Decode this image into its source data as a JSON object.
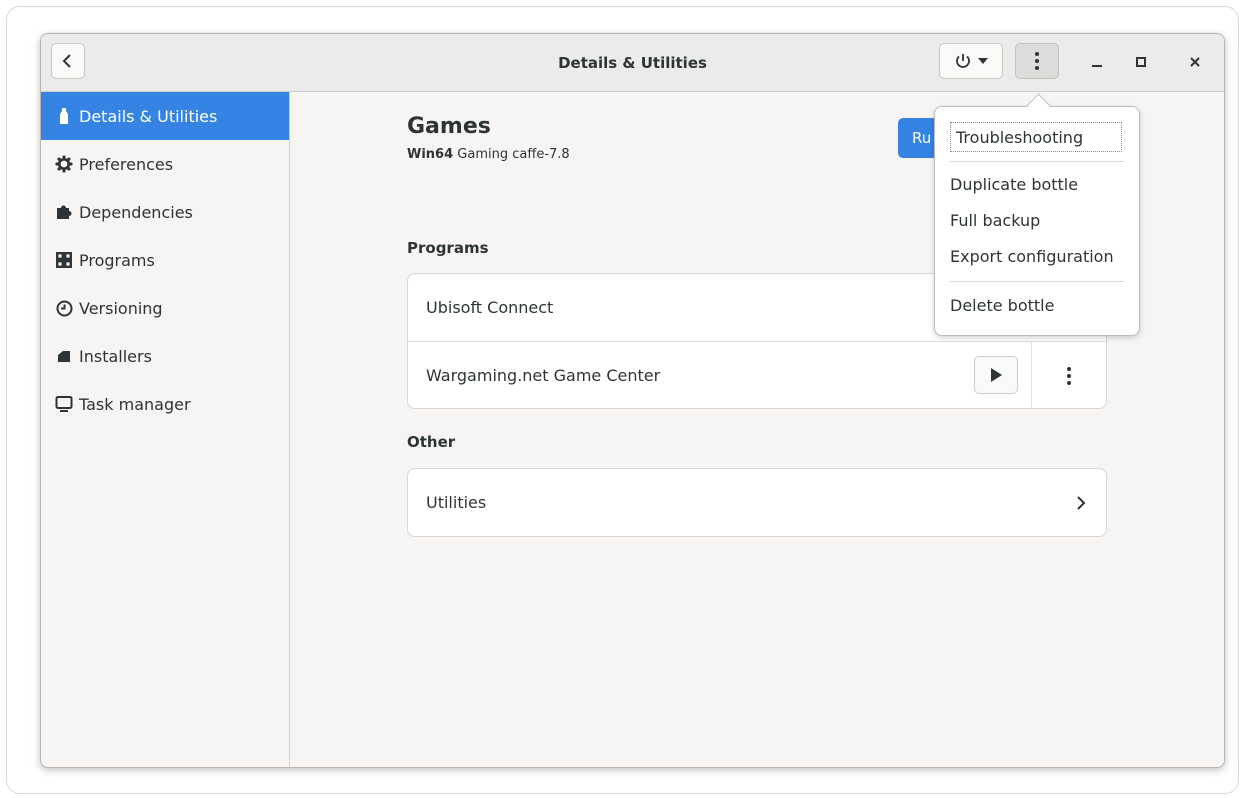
{
  "window": {
    "title": "Details & Utilities"
  },
  "sidebar": {
    "items": [
      {
        "label": "Details & Utilities",
        "icon": "bottle-icon",
        "active": true
      },
      {
        "label": "Preferences",
        "icon": "gear-icon"
      },
      {
        "label": "Dependencies",
        "icon": "puzzle-icon"
      },
      {
        "label": "Programs",
        "icon": "grid-icon"
      },
      {
        "label": "Versioning",
        "icon": "clock-icon"
      },
      {
        "label": "Installers",
        "icon": "package-icon"
      },
      {
        "label": "Task manager",
        "icon": "monitor-icon"
      }
    ]
  },
  "bottle": {
    "name": "Games",
    "arch": "Win64",
    "environment": "Gaming",
    "runner": "caffe-7.8",
    "run_label": "Ru"
  },
  "programs": {
    "title": "Programs",
    "items": [
      {
        "name": "Ubisoft Connect"
      },
      {
        "name": "Wargaming.net Game Center"
      }
    ]
  },
  "other": {
    "title": "Other",
    "items": [
      {
        "name": "Utilities"
      }
    ]
  },
  "menu": {
    "items": [
      "Troubleshooting",
      "Duplicate bottle",
      "Full backup",
      "Export configuration",
      "Delete bottle"
    ]
  },
  "colors": {
    "accent": "#3584e4",
    "headerbar": "#ebebeb",
    "sidebar": "#f6f5f4"
  }
}
